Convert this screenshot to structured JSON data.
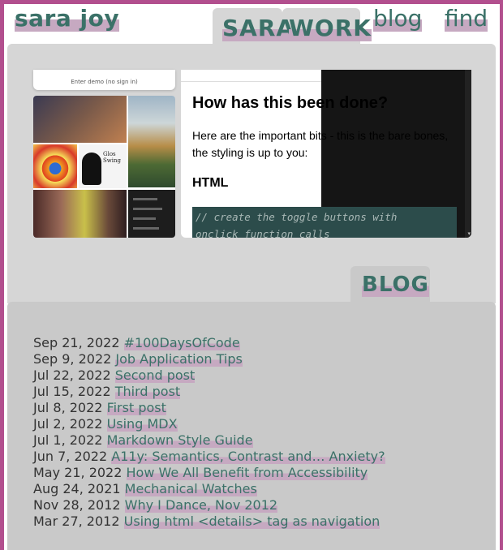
{
  "header": {
    "logo": "sara joy",
    "nav": {
      "sara": "SARA",
      "work": "WORK",
      "blog": "blog",
      "find": "find"
    }
  },
  "work": {
    "screenshot_caption": "Enter demo (no sign in)",
    "tutorial": {
      "heading": "How has this been done?",
      "paragraph": "Here are the important bits - this is the bare bones, the styling is up to you:",
      "subheading": "HTML",
      "code_lines": [
        "// create the toggle buttons with",
        "onclick function calls"
      ]
    }
  },
  "blog": {
    "tab_label": "BLOG",
    "posts": [
      {
        "date": "Sep 21, 2022",
        "title": "#100DaysOfCode"
      },
      {
        "date": "Sep 9, 2022",
        "title": "Job Application Tips"
      },
      {
        "date": "Jul 22, 2022",
        "title": "Second post"
      },
      {
        "date": "Jul 15, 2022",
        "title": "Third post"
      },
      {
        "date": "Jul 8, 2022",
        "title": "First post"
      },
      {
        "date": "Jul 2, 2022",
        "title": "Using MDX"
      },
      {
        "date": "Jul 1, 2022",
        "title": "Markdown Style Guide"
      },
      {
        "date": "Jun 7, 2022",
        "title": "A11y: Semantics, Contrast and… Anxiety?"
      },
      {
        "date": "May 21, 2022",
        "title": "How We All Benefit from Accessibility"
      },
      {
        "date": "Aug 24, 2021",
        "title": "Mechanical Watches"
      },
      {
        "date": "Nov 28, 2012",
        "title": "Why I Dance, Nov 2012"
      },
      {
        "date": "Mar 27, 2012",
        "title": "Using html <details> tag as navigation"
      }
    ]
  },
  "colors": {
    "accent": "#3b7168",
    "border": "#b24f8e",
    "highlight": "#c6a9c1",
    "panel": "#d6d6d6",
    "blog_panel": "#c9c9c9"
  }
}
